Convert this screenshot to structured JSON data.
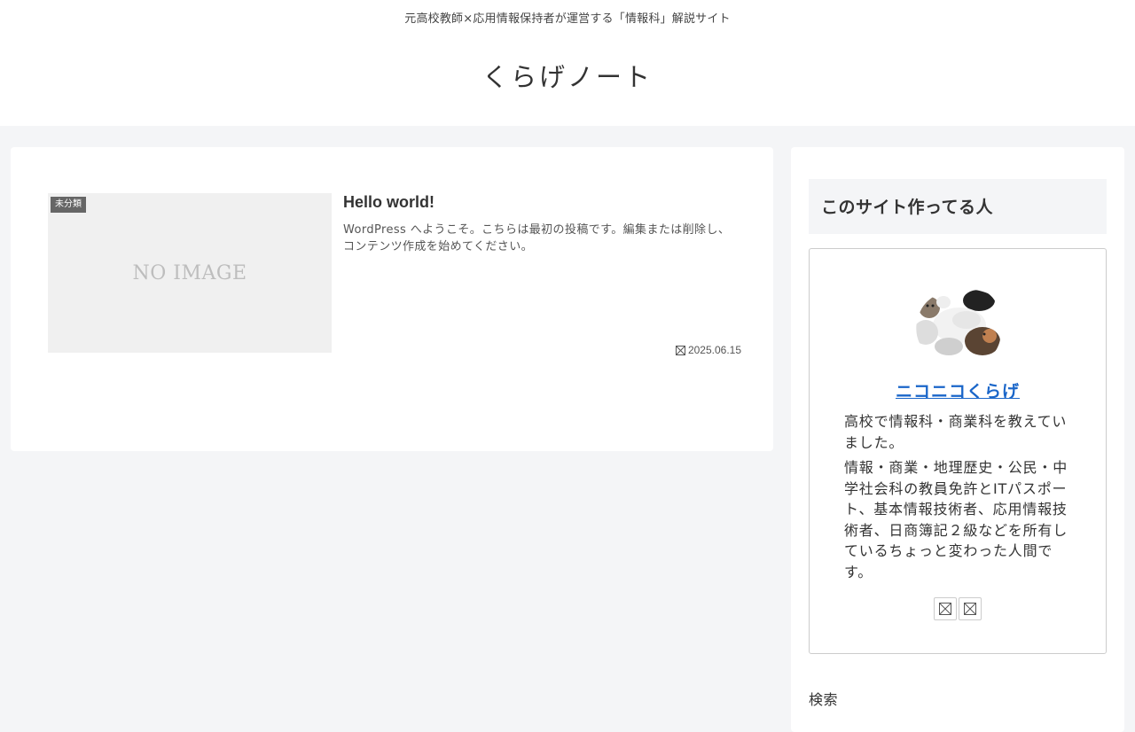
{
  "header": {
    "tagline": "元高校教師×応用情報保持者が運営する「情報科」解説サイト",
    "site_title": "くらげノート"
  },
  "main": {
    "posts": [
      {
        "category": "未分類",
        "thumbnail_text": "NO IMAGE",
        "title": "Hello world!",
        "snippet": "WordPress へようこそ。こちらは最初の投稿です。編集または削除し、コンテンツ作成を始めてください。",
        "date": "2025.06.15",
        "date_icon": "clock-icon"
      }
    ]
  },
  "sidebar": {
    "profile_widget_title": "このサイト作ってる人",
    "author_name": "ニコニコくらげ",
    "bio": [
      "高校で情報科・商業科を教えていました。",
      "情報・商業・地理歴史・公民・中学社会科の教員免許とITパスポート、基本情報技術者、応用情報技術者、日商簿記２級などを所有しているちょっと変わった人間です。"
    ],
    "sns_icons": [
      "sns-icon",
      "sns-icon"
    ],
    "search_heading": "検索"
  },
  "colors": {
    "page_bg": "#f4f5f7",
    "card_bg": "#ffffff",
    "author_link": "#1a66c9",
    "category_label_bg": "#666666"
  }
}
